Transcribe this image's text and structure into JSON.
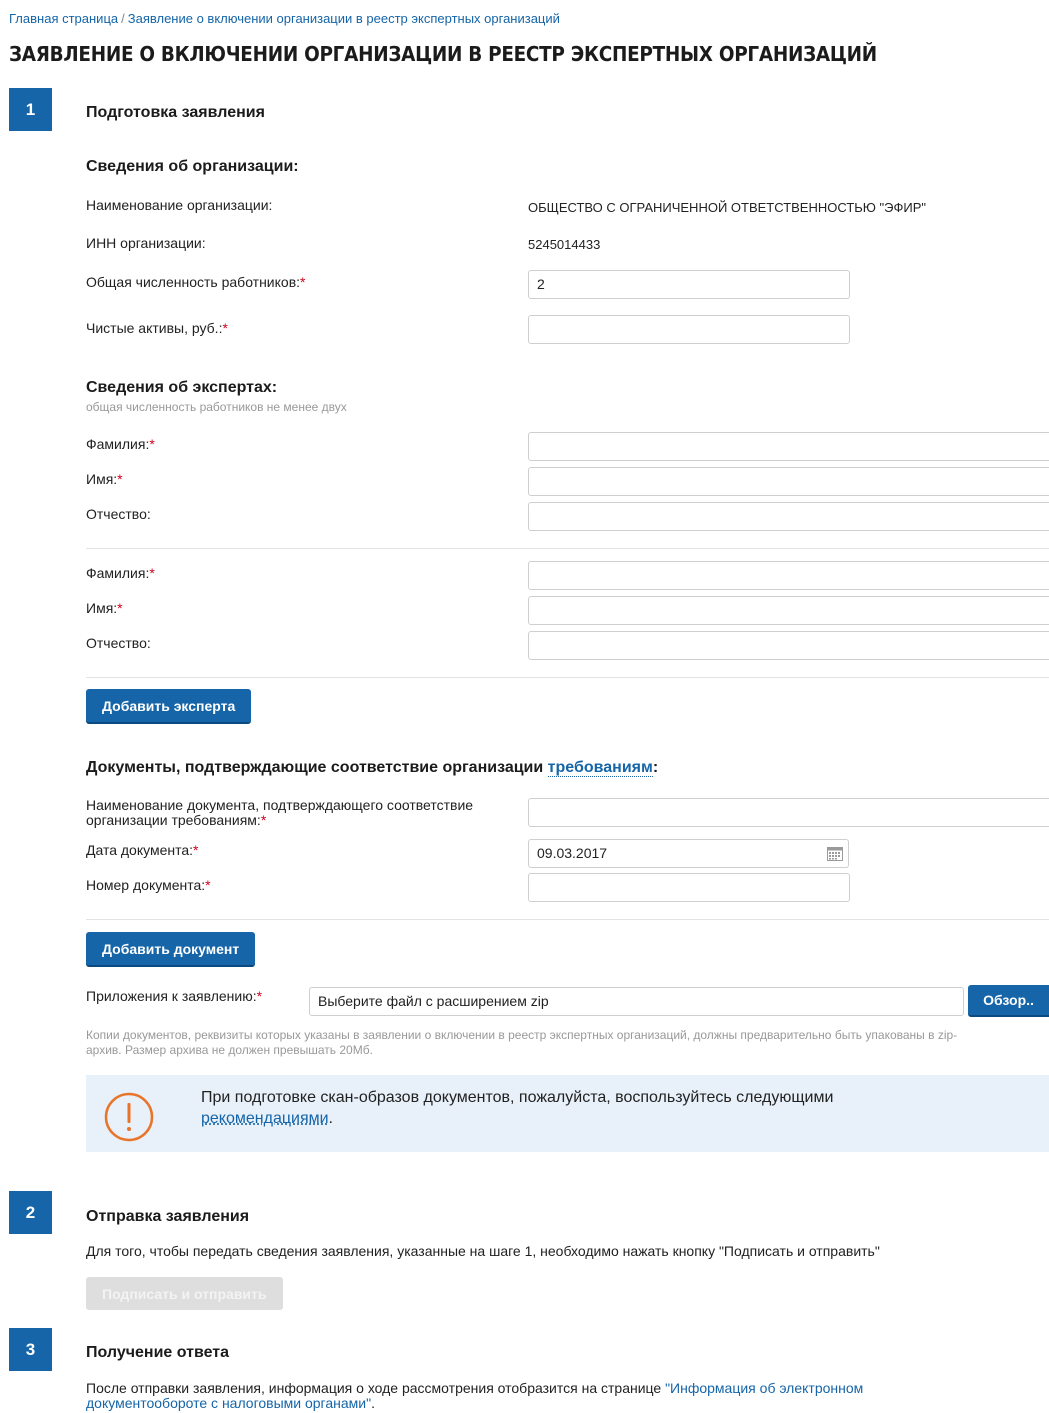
{
  "breadcrumb": {
    "home": "Главная страница",
    "separator": "/",
    "current": "Заявление о включении организации в реестр экспертных организаций"
  },
  "page_title": "ЗАЯВЛЕНИЕ О ВКЛЮЧЕНИИ ОРГАНИЗАЦИИ В РЕЕСТР ЭКСПЕРТНЫХ ОРГАНИЗАЦИЙ",
  "steps": [
    {
      "number": "1",
      "title": "Подготовка заявления"
    },
    {
      "number": "2",
      "title": "Отправка заявления"
    },
    {
      "number": "3",
      "title": "Получение ответа"
    }
  ],
  "organization": {
    "section_title": "Сведения об организации:",
    "name_label": "Наименование организации:",
    "name_value": "ОБЩЕСТВО С ОГРАНИЧЕННОЙ ОТВЕТСТВЕННОСТЬЮ \"ЭФИР\"",
    "inn_label": "ИНН организации:",
    "inn_value": "5245014433",
    "employees_label": "Общая численность работников:",
    "employees_value": "2",
    "assets_label": "Чистые активы, руб.:",
    "assets_value": ""
  },
  "experts": {
    "section_title": "Сведения об экспертах:",
    "hint": "общая численность работников не менее двух",
    "surname_label": "Фамилия:",
    "name_label": "Имя:",
    "patronymic_label": "Отчество:",
    "add_button": "Добавить эксперта"
  },
  "documents": {
    "section_title": "Документы, подтверждающие соответствие организации ",
    "section_link": "требованиям",
    "section_colon": ":",
    "doc_name_label_1": "Наименование документа, подтверждающего соответствие",
    "doc_name_label_2": "организации требованиям:",
    "doc_date_label": "Дата документа:",
    "doc_date_value": "09.03.2017",
    "doc_number_label": "Номер документа:",
    "add_button": "Добавить документ"
  },
  "attachments": {
    "label": "Приложения к заявлению:",
    "placeholder": "Выберите файл с расширением zip",
    "browse_button": "Обзор..",
    "hint_1": "Копии документов, реквизиты которых указаны в заявлении о включении в реестр экспертных организаций, должны предварительно быть упакованы в zip-",
    "hint_2": "архив. Размер архива не должен превышать 20Мб."
  },
  "notice": {
    "text": "При подготовке скан-образов документов, пожалуйста, воспользуйтесь следующими",
    "link": "рекомендациями",
    "end": "."
  },
  "send": {
    "text": "Для того, чтобы передать сведения заявления, указанные на шаге 1, необходимо нажать кнопку \"Подписать и отправить\"",
    "button": "Подписать и отправить"
  },
  "answer": {
    "text": "После отправки заявления, информация о ходе рассмотрения отобразится на странице ",
    "link_1": "\"Информация об электронном",
    "link_2": "документообороте с налоговыми органами\"",
    "end": "."
  },
  "required_mark": "*",
  "colors": {
    "accent": "#1565a8",
    "required": "#d0021b",
    "notice_bg": "#e8f0f9",
    "warning": "#e8742a"
  }
}
